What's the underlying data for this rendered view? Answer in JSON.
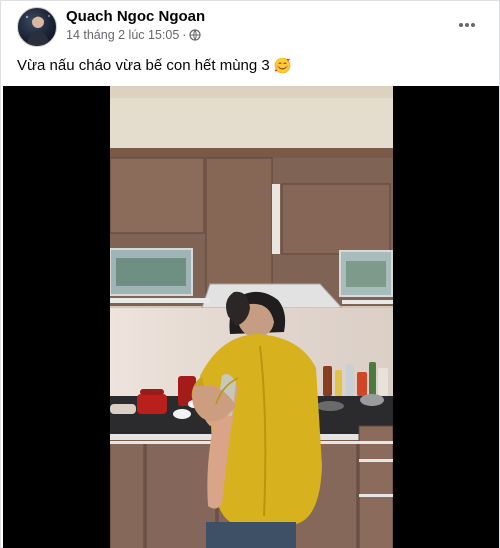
{
  "post": {
    "author_name": "Quach Ngoc Ngoan",
    "timestamp": "14 tháng 2 lúc 15:05",
    "separator": "·",
    "privacy_icon": "globe-icon",
    "more_icon": "more-options-icon",
    "caption": "Vừa nấu cháo vừa bế con hết mùng 3",
    "caption_emoji": "smiling-face-with-hearts"
  },
  "colors": {
    "meta_text": "#65676b",
    "name_text": "#050505",
    "media_background": "#000000"
  }
}
